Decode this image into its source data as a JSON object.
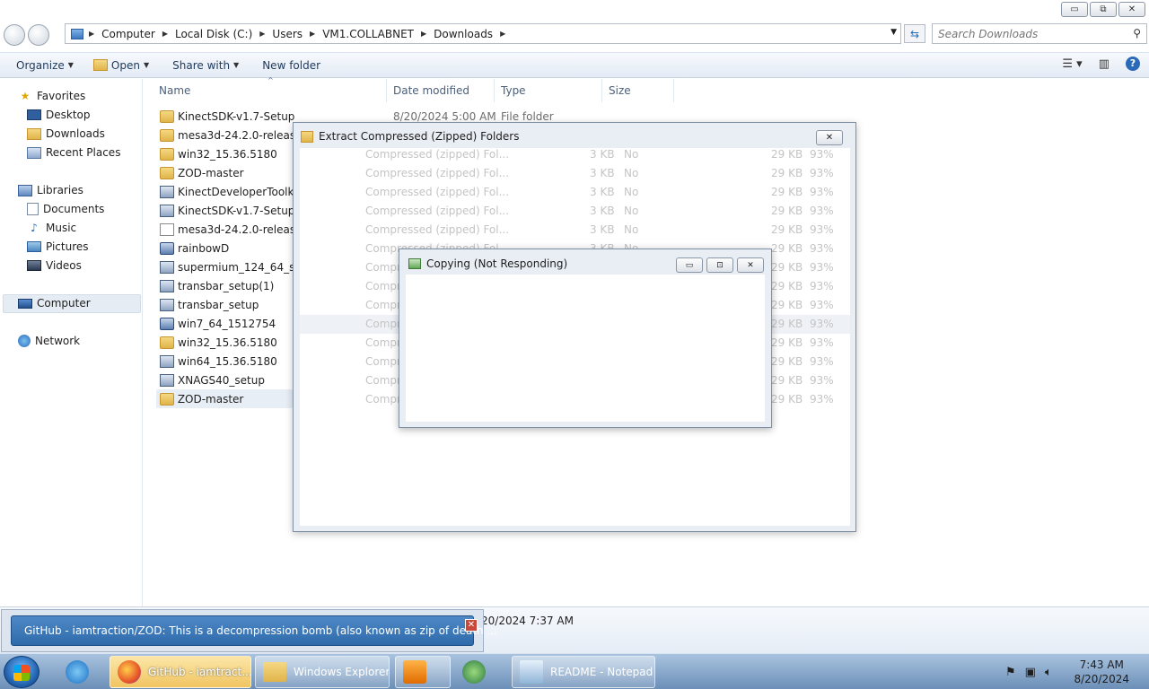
{
  "window_caps": {
    "minimize": "▭",
    "restore": "⧉",
    "close": "✕"
  },
  "address": {
    "crumbs": [
      "Computer",
      "Local Disk (C:)",
      "Users",
      "VM1.COLLABNET",
      "Downloads"
    ]
  },
  "search": {
    "placeholder": "Search Downloads"
  },
  "toolbar": {
    "organize": "Organize",
    "open": "Open",
    "share_with": "Share with",
    "new_folder": "New folder"
  },
  "navpane": {
    "favorites": "Favorites",
    "desktop": "Desktop",
    "downloads": "Downloads",
    "recent_places": "Recent Places",
    "libraries": "Libraries",
    "documents": "Documents",
    "music": "Music",
    "pictures": "Pictures",
    "videos": "Videos",
    "computer": "Computer",
    "network": "Network"
  },
  "columns": {
    "name": "Name",
    "date": "Date modified",
    "type": "Type",
    "size": "Size"
  },
  "files": [
    {
      "name": "KinectSDK-v1.7-Setup",
      "icon": "folder",
      "date": "8/20/2024 5:00 AM",
      "type": "File folder"
    },
    {
      "name": "mesa3d-24.2.0-release-m",
      "icon": "folder",
      "date": "",
      "type": ""
    },
    {
      "name": "win32_15.36.5180",
      "icon": "folder",
      "date": "",
      "type": ""
    },
    {
      "name": "ZOD-master",
      "icon": "folder",
      "date": "",
      "type": ""
    },
    {
      "name": "KinectDeveloperToolkit-",
      "icon": "setup",
      "date": "",
      "type": ""
    },
    {
      "name": "KinectSDK-v1.7-Setup",
      "icon": "setup",
      "date": "",
      "type": ""
    },
    {
      "name": "mesa3d-24.2.0-release-m",
      "icon": "doc",
      "date": "",
      "type": ""
    },
    {
      "name": "rainbowD",
      "icon": "app",
      "date": "",
      "type": ""
    },
    {
      "name": "supermium_124_64_setu",
      "icon": "setup",
      "date": "",
      "type": ""
    },
    {
      "name": "transbar_setup(1)",
      "icon": "setup",
      "date": "",
      "type": ""
    },
    {
      "name": "transbar_setup",
      "icon": "setup",
      "date": "",
      "type": ""
    },
    {
      "name": "win7_64_1512754",
      "icon": "app",
      "date": "",
      "type": ""
    },
    {
      "name": "win32_15.36.5180",
      "icon": "folder",
      "date": "",
      "type": ""
    },
    {
      "name": "win64_15.36.5180",
      "icon": "setup",
      "date": "",
      "type": ""
    },
    {
      "name": "XNAGS40_setup",
      "icon": "setup",
      "date": "",
      "type": ""
    },
    {
      "name": "ZOD-master",
      "icon": "folder",
      "date": "",
      "type": ""
    }
  ],
  "extract_dialog": {
    "title": "Extract Compressed (Zipped) Folders",
    "close": "✕",
    "rows": [
      {
        "type": "Compressed (zipped) Fol...",
        "packed": "3 KB",
        "protected": "No",
        "size": "29 KB",
        "ratio": "93%"
      },
      {
        "type": "Compressed (zipped) Fol...",
        "packed": "3 KB",
        "protected": "No",
        "size": "29 KB",
        "ratio": "93%"
      },
      {
        "type": "Compressed (zipped) Fol...",
        "packed": "3 KB",
        "protected": "No",
        "size": "29 KB",
        "ratio": "93%"
      },
      {
        "type": "Compressed (zipped) Fol...",
        "packed": "3 KB",
        "protected": "No",
        "size": "29 KB",
        "ratio": "93%"
      },
      {
        "type": "Compressed (zipped) Fol...",
        "packed": "3 KB",
        "protected": "No",
        "size": "29 KB",
        "ratio": "93%"
      },
      {
        "type": "Compressed (zipped) Fol...",
        "packed": "3 KB",
        "protected": "No",
        "size": "29 KB",
        "ratio": "93%"
      },
      {
        "type": "Compr",
        "packed": "",
        "protected": "",
        "size": "29 KB",
        "ratio": "93%"
      },
      {
        "type": "Compr",
        "packed": "",
        "protected": "",
        "size": "29 KB",
        "ratio": "93%"
      },
      {
        "type": "Compr",
        "packed": "",
        "protected": "",
        "size": "29 KB",
        "ratio": "93%"
      },
      {
        "type": "Compr",
        "packed": "",
        "protected": "",
        "size": "29 KB",
        "ratio": "93%"
      },
      {
        "type": "Compr",
        "packed": "",
        "protected": "",
        "size": "29 KB",
        "ratio": "93%"
      },
      {
        "type": "Compr",
        "packed": "",
        "protected": "",
        "size": "29 KB",
        "ratio": "93%"
      },
      {
        "type": "Compr",
        "packed": "",
        "protected": "",
        "size": "29 KB",
        "ratio": "93%"
      },
      {
        "type": "Compr",
        "packed": "",
        "protected": "",
        "size": "29 KB",
        "ratio": "93%"
      }
    ]
  },
  "copying_dialog": {
    "title": "Copying  (Not Responding)",
    "minimize": "▭",
    "restore": "⊡",
    "close": "✕"
  },
  "details": {
    "text": "20/2024 7:37 AM"
  },
  "tooltip": {
    "text": "GitHub - iamtraction/ZOD: This is a decompression bomb (also known as zip of death ...",
    "close": "✕"
  },
  "taskbar": {
    "firefox": "GitHub - iamtract...",
    "explorer": "Windows Explorer",
    "notepad": "README - Notepad"
  },
  "clock": {
    "time": "7:43 AM",
    "date": "8/20/2024"
  },
  "colors": {
    "taskbar": "#6c8fb8",
    "active_task": "#f1c561",
    "accent": "#2f6bab"
  }
}
